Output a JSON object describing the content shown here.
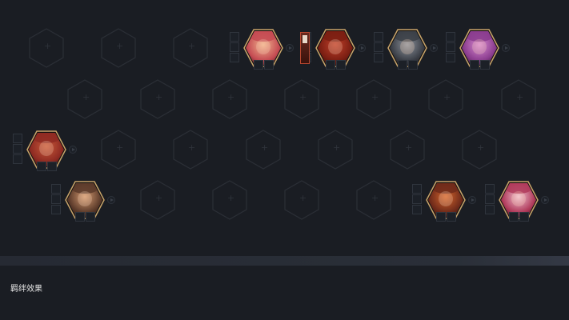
{
  "colors": {
    "background": "#1a1d23",
    "hex_outline": "#2b2f36",
    "gold_border": "#c9a46a",
    "text": "#e6e6e6"
  },
  "board": {
    "empty_hex_icon": "plus-icon",
    "units": [
      {
        "id": "unit-1",
        "portrait_colors": [
          "#c44a52",
          "#f0b38d"
        ],
        "has_item": false
      },
      {
        "id": "unit-2",
        "portrait_colors": [
          "#7a1e12",
          "#c0402a"
        ],
        "has_item": true
      },
      {
        "id": "unit-3",
        "portrait_colors": [
          "#3b3f47",
          "#8d939c"
        ],
        "has_item": false
      },
      {
        "id": "unit-4",
        "portrait_colors": [
          "#8a3c8e",
          "#d88ad0"
        ],
        "has_item": false
      },
      {
        "id": "unit-5",
        "portrait_colors": [
          "#8e2a22",
          "#c85a3a"
        ],
        "has_item": false
      },
      {
        "id": "unit-6",
        "portrait_colors": [
          "#5b3a2a",
          "#d49a70"
        ],
        "has_item": false
      },
      {
        "id": "unit-7",
        "portrait_colors": [
          "#6e2a1a",
          "#d4652c"
        ],
        "has_item": false
      },
      {
        "id": "unit-8",
        "portrait_colors": [
          "#b03a5a",
          "#f0c0d0"
        ],
        "has_item": false
      }
    ]
  },
  "traits": {
    "title": "羁绊效果"
  }
}
